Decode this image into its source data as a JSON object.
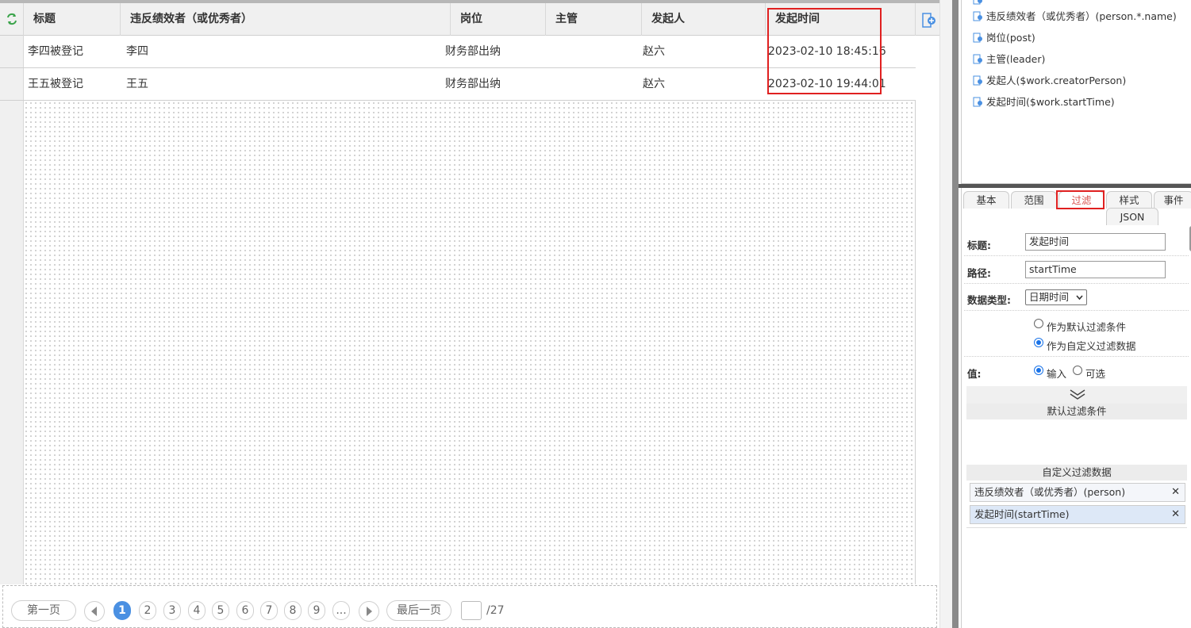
{
  "grid": {
    "columns": [
      "标题",
      "违反绩效者（或优秀者）",
      "岗位",
      "主管",
      "发起人",
      "发起时间"
    ],
    "rows": [
      {
        "title": "李四被登记",
        "person": "李四",
        "post": "财务部出纳",
        "leader": "",
        "creator": "赵六",
        "start": "2023-02-10 18:45:16"
      },
      {
        "title": "王五被登记",
        "person": "王五",
        "post": "财务部出纳",
        "leader": "",
        "creator": "赵六",
        "start": "2023-02-10 19:44:01"
      }
    ]
  },
  "pager": {
    "first": "第一页",
    "last": "最后一页",
    "pages": [
      "1",
      "2",
      "3",
      "4",
      "5",
      "6",
      "7",
      "8",
      "9",
      "..."
    ],
    "current": "1",
    "total": "/27"
  },
  "field_list": [
    "违反绩效者（或优秀者）(person.*.name)",
    "岗位(post)",
    "主管(leader)",
    "发起人($work.creatorPerson)",
    "发起时间($work.startTime)"
  ],
  "tabs": {
    "row1": [
      "基本",
      "范围",
      "过滤",
      "样式",
      "事件"
    ],
    "row2": [
      "JSON"
    ],
    "active": "过滤"
  },
  "props": {
    "title_label": "标题:",
    "title_value": "发起时间",
    "path_label": "路径:",
    "path_value": "startTime",
    "type_label": "数据类型:",
    "type_value": "日期时间",
    "opt_default": "作为默认过滤条件",
    "opt_custom": "作为自定义过滤数据",
    "value_label": "值:",
    "value_input": "输入",
    "value_select": "可选",
    "default_section": "默认过滤条件",
    "custom_section": "自定义过滤数据",
    "custom_items": [
      "违反绩效者（或优秀者）(person)",
      "发起时间(startTime)"
    ]
  },
  "colors": {
    "accent": "#4a90e2",
    "highlight": "#e02020",
    "active_tab": "#d9534f",
    "selected_chip": "#dde8f7"
  }
}
